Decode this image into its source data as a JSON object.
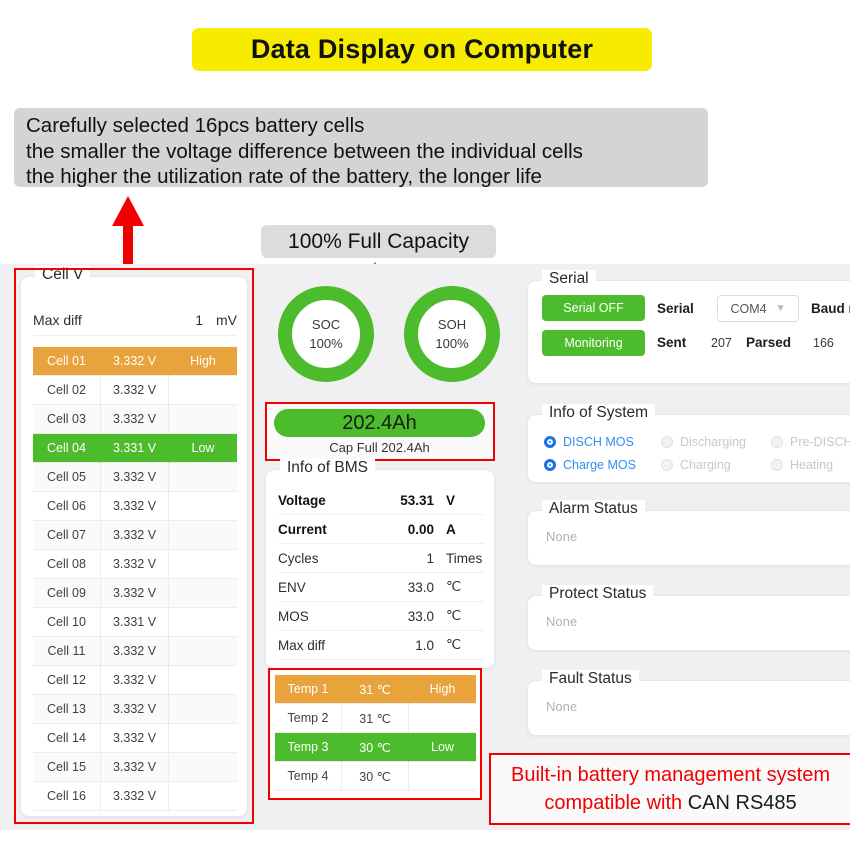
{
  "banner": {
    "title": "Data Display on Computer"
  },
  "description": {
    "line1": "Carefully selected 16pcs battery cells",
    "line2": "the smaller the voltage difference between the individual cells",
    "line3": "the higher the utilization rate of the battery, the longer life"
  },
  "capacity_callout": {
    "label": "100% Full Capacity"
  },
  "cell_panel": {
    "legend": "Cell V",
    "max_diff_label": "Max diff",
    "max_diff_value": "1",
    "max_diff_unit": "mV",
    "rows": [
      {
        "name": "Cell 01",
        "value": "3.332 V",
        "tag": "High"
      },
      {
        "name": "Cell 02",
        "value": "3.332 V",
        "tag": ""
      },
      {
        "name": "Cell 03",
        "value": "3.332 V",
        "tag": ""
      },
      {
        "name": "Cell 04",
        "value": "3.331 V",
        "tag": "Low"
      },
      {
        "name": "Cell 05",
        "value": "3.332 V",
        "tag": ""
      },
      {
        "name": "Cell 06",
        "value": "3.332 V",
        "tag": ""
      },
      {
        "name": "Cell 07",
        "value": "3.332 V",
        "tag": ""
      },
      {
        "name": "Cell 08",
        "value": "3.332 V",
        "tag": ""
      },
      {
        "name": "Cell 09",
        "value": "3.332 V",
        "tag": ""
      },
      {
        "name": "Cell 10",
        "value": "3.331 V",
        "tag": ""
      },
      {
        "name": "Cell 11",
        "value": "3.332 V",
        "tag": ""
      },
      {
        "name": "Cell 12",
        "value": "3.332 V",
        "tag": ""
      },
      {
        "name": "Cell 13",
        "value": "3.332 V",
        "tag": ""
      },
      {
        "name": "Cell 14",
        "value": "3.332 V",
        "tag": ""
      },
      {
        "name": "Cell 15",
        "value": "3.332 V",
        "tag": ""
      },
      {
        "name": "Cell 16",
        "value": "3.332 V",
        "tag": ""
      }
    ]
  },
  "gauges": {
    "soc": {
      "title": "SOC",
      "value": "100%"
    },
    "soh": {
      "title": "SOH",
      "value": "100%"
    }
  },
  "capacity": {
    "bar_value": "202.4Ah",
    "sub_text": "Cap Full  202.4Ah"
  },
  "bms_panel": {
    "legend": "Info of BMS",
    "rows": [
      {
        "label": "Voltage",
        "value": "53.31",
        "unit": "V"
      },
      {
        "label": "Current",
        "value": "0.00",
        "unit": "A"
      },
      {
        "label": "Cycles",
        "value": "1",
        "unit": "Times"
      },
      {
        "label": "ENV",
        "value": "33.0",
        "unit": "℃"
      },
      {
        "label": "MOS",
        "value": "33.0",
        "unit": "℃"
      },
      {
        "label": "Max diff",
        "value": "1.0",
        "unit": "℃"
      }
    ]
  },
  "temp_table": {
    "rows": [
      {
        "name": "Temp 1",
        "value": "31 ℃",
        "tag": "High"
      },
      {
        "name": "Temp 2",
        "value": "31 ℃",
        "tag": ""
      },
      {
        "name": "Temp 3",
        "value": "30 ℃",
        "tag": "Low"
      },
      {
        "name": "Temp 4",
        "value": "30 ℃",
        "tag": ""
      }
    ]
  },
  "serial_panel": {
    "legend": "Serial",
    "serial_off_button": "Serial OFF",
    "monitoring_button": "Monitoring",
    "serial_label": "Serial",
    "port_value": "COM4",
    "chevron": "▼",
    "baud_label": "Baud r",
    "sent_label": "Sent",
    "sent_value": "207",
    "parsed_label": "Parsed",
    "parsed_value": "166"
  },
  "system_panel": {
    "legend": "Info of System",
    "items": [
      {
        "label": "DISCH MOS",
        "state": "on"
      },
      {
        "label": "Charge MOS",
        "state": "on"
      },
      {
        "label": "Discharging",
        "state": "off"
      },
      {
        "label": "Charging",
        "state": "off"
      },
      {
        "label": "Pre-DISCH",
        "state": "off"
      },
      {
        "label": "Heating",
        "state": "off"
      }
    ]
  },
  "alarm_panel": {
    "legend": "Alarm Status",
    "value": "None"
  },
  "protect_panel": {
    "legend": "Protect Status",
    "value": "None"
  },
  "fault_panel": {
    "legend": "Fault Status",
    "value": "None"
  },
  "note": {
    "line1": "Built-in battery management system",
    "line2_red": "compatible with ",
    "line2_black": "CAN RS485"
  },
  "colors": {
    "banner_yellow": "#f7ec00",
    "accent_green": "#4cbb2c",
    "accent_orange": "#e8a33d",
    "highlight_red": "#f20000",
    "radio_blue": "#1a73e8"
  }
}
